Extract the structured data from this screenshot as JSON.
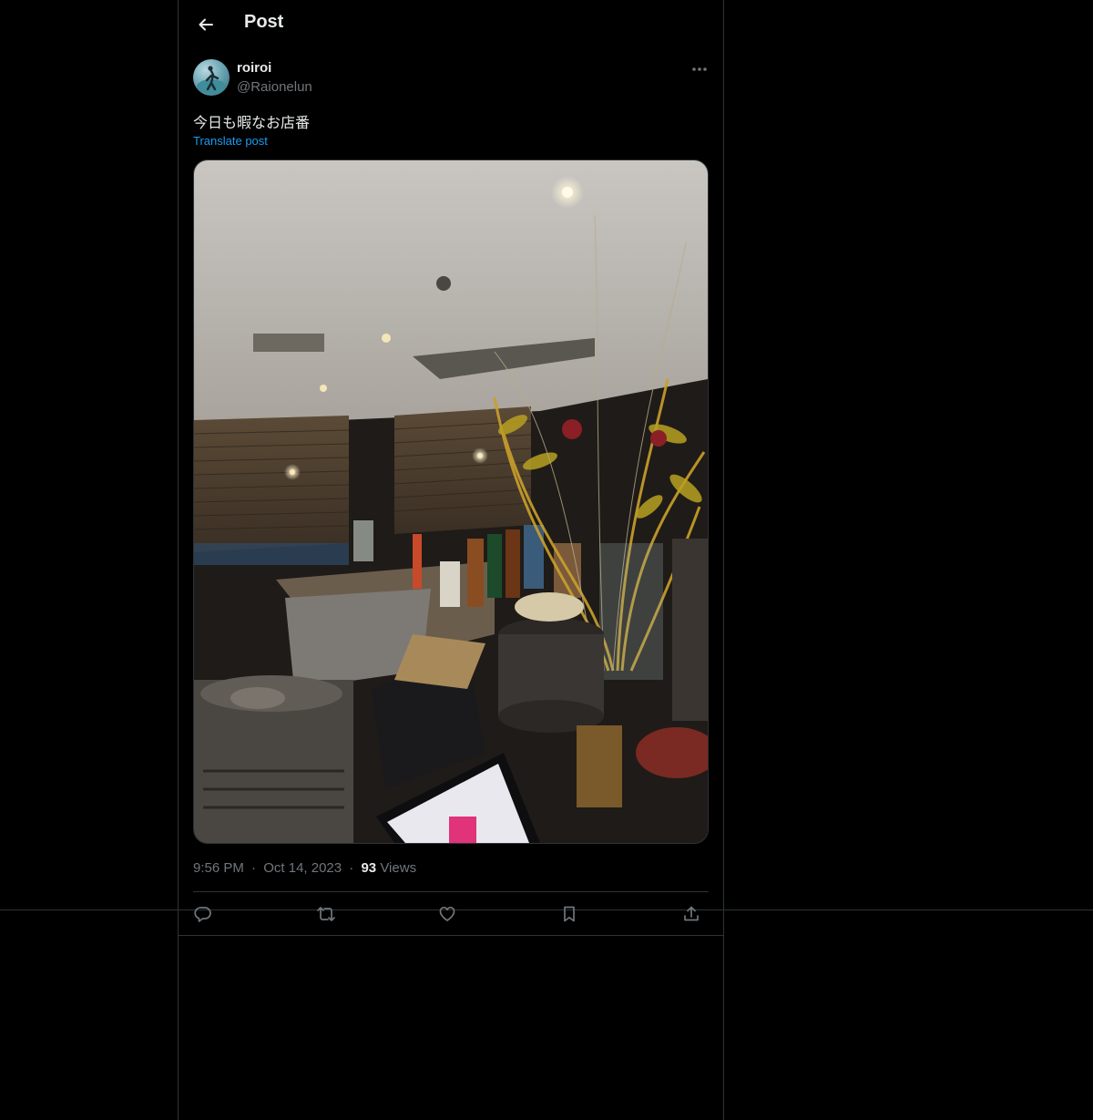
{
  "header": {
    "title": "Post",
    "back_icon": "arrow-left-icon"
  },
  "post": {
    "author_name": "roiroi",
    "author_handle": "@Raionelun",
    "text": "今日も暇なお店番",
    "translate_label": "Translate post",
    "time": "9:56 PM",
    "date": "Oct 14, 2023",
    "separator": "·",
    "views_count": "93",
    "views_label": "Views"
  },
  "actions": [
    {
      "name": "reply",
      "icon": "reply-icon"
    },
    {
      "name": "repost",
      "icon": "repost-icon"
    },
    {
      "name": "like",
      "icon": "heart-icon"
    },
    {
      "name": "bookmark",
      "icon": "bookmark-icon"
    },
    {
      "name": "share",
      "icon": "share-icon"
    }
  ],
  "colors": {
    "background": "#000000",
    "text": "#e7e9ea",
    "secondary": "#71767b",
    "link": "#1d9bf0",
    "border": "#2f3336"
  }
}
